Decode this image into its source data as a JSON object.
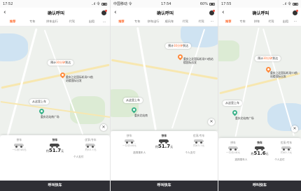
{
  "screens": [
    {
      "status": {
        "time": "17:52",
        "signal": "..ıl 令 ",
        "battery": "60%"
      },
      "header": {
        "title": "确认呼叫",
        "back": "‹"
      },
      "tabs": [
        "推荐",
        "专车",
        "拼车出行",
        "代驾",
        "出租",
        "..."
      ],
      "map": {
        "destination_bubble": {
          "prefix": "预计",
          "highlight": "30分钟",
          "suffix": "到达"
        },
        "destination_label": "重庆江北国际机场T3航站楼国际出发",
        "start_bubble": "从这里上车",
        "start_label": "重庆北站南广场"
      },
      "cars": [
        {
          "name": "拼车",
          "price_prefix": "一口价",
          "price": "48元"
        },
        {
          "name": "快车",
          "price_prefix": "约",
          "price": "51.7",
          "unit": "元"
        },
        {
          "name": "优享/专车",
          "price_prefix": "约",
          "price": "63.7元"
        }
      ],
      "options": [
        "",
        "个人支付"
      ],
      "cta": "呼叫快车"
    },
    {
      "status": {
        "time": "17:54",
        "signal": "中国移动 令",
        "battery": "60%"
      },
      "header": {
        "title": "确认呼叫",
        "back": "‹"
      },
      "tabs": [
        "推荐",
        "专车",
        "拼车出行",
        "顺风车",
        "代驾",
        "代驾",
        "⋯"
      ],
      "map": {
        "destination_bubble": {
          "prefix": "预计",
          "highlight": "30分钟",
          "suffix": "到达"
        },
        "destination_label": "重庆江北国际机场T3航站楼国际出发",
        "start_bubble": "从这里上车",
        "start_label": "重庆北站南"
      },
      "cars": [
        {
          "name": "拼车",
          "price_prefix": "一口价",
          "price": "48元"
        },
        {
          "name": "快车",
          "price_prefix": "约",
          "price": "51.7",
          "unit": "元"
        },
        {
          "name": "优享/专车",
          "price_prefix": "约",
          "price": "63.7元"
        }
      ],
      "options": [
        "选择乘车人",
        "个人支付"
      ],
      "cta": "呼叫快车"
    },
    {
      "status": {
        "time": "17:55",
        "signal": "..ıl 令",
        "battery": ""
      },
      "header": {
        "title": "确认呼叫",
        "back": "‹"
      },
      "tabs": [
        "推荐",
        "专车",
        "拼车",
        "代驾",
        "出租",
        "⋯"
      ],
      "map": {
        "destination_bubble": {
          "prefix": "预计",
          "highlight": "30分钟",
          "suffix": "到达"
        },
        "destination_label": "重庆江北国际机场T3航站楼国际出发",
        "start_bubble": "从这里上车",
        "start_label": "重庆北站南广场"
      },
      "cars": [
        {
          "name": "拼车",
          "price_prefix": "一口价",
          "price": "48元"
        },
        {
          "name": "快车",
          "price_prefix": "约",
          "price": "51.6",
          "unit": "元"
        },
        {
          "name": "优享/专车",
          "price_prefix": "约",
          "price": "63.7元"
        }
      ],
      "options": [
        "选择乘车人",
        "个人支付"
      ],
      "cta": "呼叫快车"
    }
  ],
  "colors": {
    "accent": "#ff6a2c",
    "start_pin": "#3bb38a",
    "end_pin": "#ff8a3c",
    "cta_bg": "#2f2f35"
  }
}
